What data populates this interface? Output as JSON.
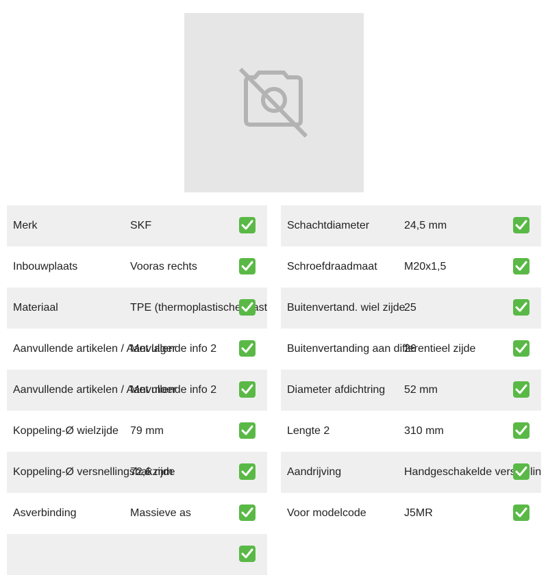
{
  "product_image": {
    "icon": "camera-off-icon"
  },
  "left_specs": [
    {
      "label": "Merk",
      "value": "SKF"
    },
    {
      "label": "Inbouwplaats",
      "value": "Vooras rechts"
    },
    {
      "label": "Materiaal",
      "value": "TPE (thermoplastische elastomeren)"
    },
    {
      "label": "Aanvullende artikelen / Aanvullende info 2",
      "value": "Met lager"
    },
    {
      "label": "Aanvullende artikelen / Aanvullende info 2",
      "value": "Met moer"
    },
    {
      "label": "Koppeling-Ø wielzijde",
      "value": "79 mm"
    },
    {
      "label": "Koppeling-Ø versnellingsbakzijde",
      "value": "72,6 mm"
    },
    {
      "label": "Asverbinding",
      "value": "Massieve as"
    },
    {
      "label": "",
      "value": ""
    }
  ],
  "right_specs": [
    {
      "label": "Schachtdiameter",
      "value": "24,5 mm"
    },
    {
      "label": "Schroefdraadmaat",
      "value": "M20x1,5"
    },
    {
      "label": "Buitenvertand. wiel zijde",
      "value": "25"
    },
    {
      "label": "Buitenvertanding aan differentieel zijde",
      "value": "26"
    },
    {
      "label": "Diameter afdichtring",
      "value": "52 mm"
    },
    {
      "label": "Lengte 2",
      "value": "310 mm"
    },
    {
      "label": "Aandrijving",
      "value": "Handgeschakelde versnellingsbak"
    },
    {
      "label": "Voor modelcode",
      "value": "J5MR"
    }
  ],
  "colors": {
    "check": "#5ab946",
    "row_shade": "#efefef",
    "placeholder": "#e6e6e6"
  }
}
